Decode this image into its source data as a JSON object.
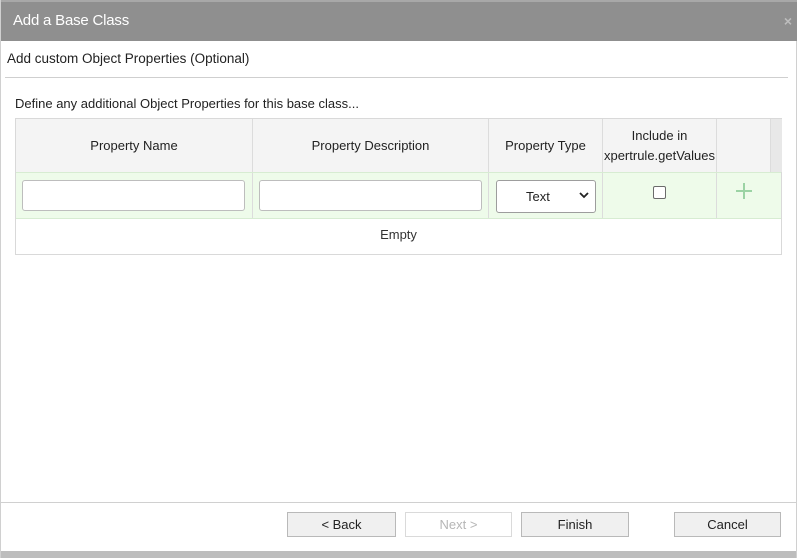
{
  "dialog": {
    "title": "Add a Base Class",
    "close_glyph": "×"
  },
  "step": {
    "title": "Add custom Object Properties (Optional)",
    "instruction": "Define any additional Object Properties for this base class..."
  },
  "table": {
    "columns": [
      "Property Name",
      "Property Description",
      "Property Type",
      "Include in xpertrule.getValues"
    ],
    "new_row": {
      "property_name": "",
      "property_description": "",
      "property_type": "Text",
      "include_checked": false,
      "add_icon": "plus-icon"
    },
    "empty_text": "Empty"
  },
  "footer": {
    "back_label": "< Back",
    "next_label": "Next >",
    "finish_label": "Finish",
    "cancel_label": "Cancel"
  },
  "colors": {
    "titlebar": "#8f8f8f",
    "new_row_bg": "#eefbea",
    "add_icon": "#9bd3a4"
  }
}
